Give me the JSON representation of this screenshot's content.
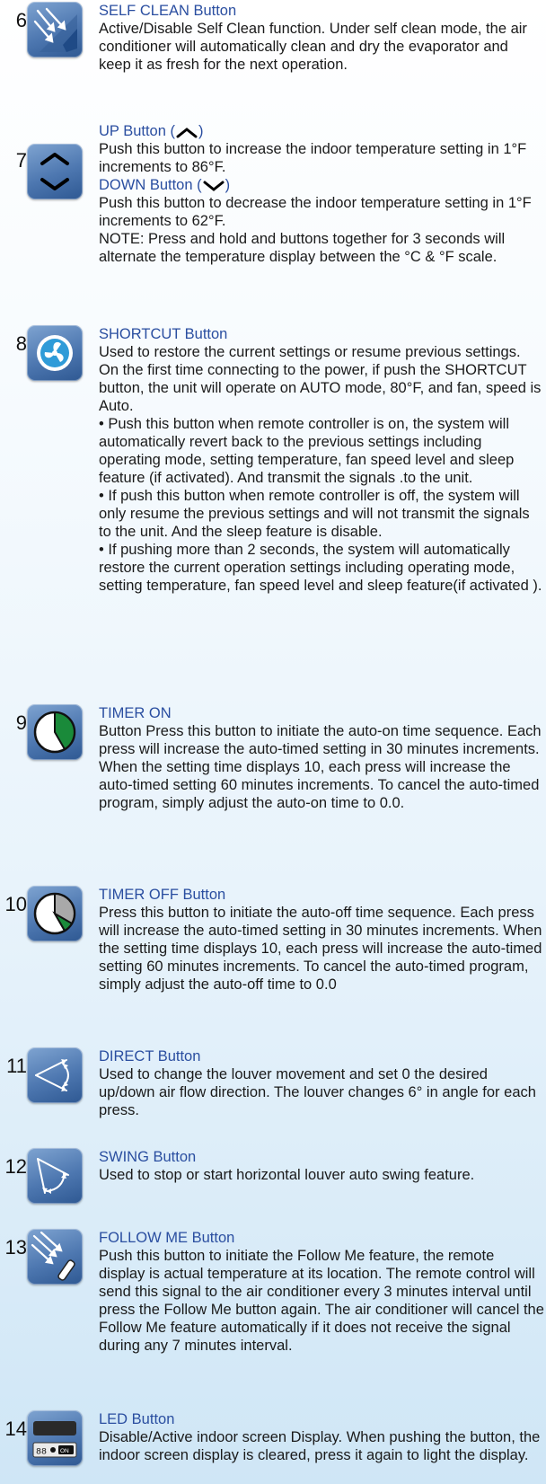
{
  "items": [
    {
      "number": "6",
      "icon": "self-clean-icon",
      "title": "SELF CLEAN Button",
      "paragraphs": [
        "Active/Disable Self Clean function. Under self clean mode, the air conditioner will automatically clean and dry the evaporator and keep it as fresh for the next operation."
      ]
    },
    {
      "number": "7",
      "icon": "up-down-icon",
      "title_up_prefix": "UP Button (",
      "title_up_suffix": ")",
      "up_text": "Push this button to increase the indoor temperature setting in 1°F increments to 86°F.",
      "title_down_prefix": "DOWN Button (",
      "title_down_suffix": ")",
      "down_text": "Push this button to decrease the indoor temperature setting in 1°F increments to 62°F.",
      "note": "NOTE: Press and hold and buttons together for 3 seconds will alternate the temperature display between the °C & °F scale."
    },
    {
      "number": "8",
      "icon": "shortcut-icon",
      "title": "SHORTCUT Button",
      "paragraphs": [
        "Used to restore the current settings or resume previous settings. On the first time connecting to the power, if push the SHORTCUT button, the unit will operate on AUTO mode, 80°F, and fan, speed is Auto.",
        "• Push this button when remote controller is on, the system will automatically revert back to the previous settings including operating mode, setting temperature, fan speed level and sleep feature (if activated). And transmit the signals .to the unit.",
        "• If push this button when remote controller is off, the system will only resume the previous settings and will not transmit the signals to the unit. And the sleep feature is disable.",
        "• If pushing more than 2 seconds, the system will automatically restore the current operation settings including operating mode, setting temperature, fan speed level and sleep feature(if activated )."
      ]
    },
    {
      "number": "9",
      "icon": "timer-on-icon",
      "title": "TIMER ON",
      "paragraphs": [
        "Button Press this button to initiate the auto-on time sequence. Each press will increase the auto-timed setting in 30 minutes increments. When the setting time displays 10, each press will increase the auto-timed setting 60 minutes increments. To cancel the auto-timed program, simply adjust the auto-on time to 0.0."
      ]
    },
    {
      "number": "10",
      "icon": "timer-off-icon",
      "title": "TIMER OFF Button",
      "paragraphs": [
        "Press this button to initiate the auto-off time sequence. Each press will increase the auto-timed setting in 30 minutes increments. When the setting time displays 10, each press will increase the auto-timed setting 60 minutes increments. To cancel the auto-timed program, simply adjust the auto-off time to 0.0"
      ]
    },
    {
      "number": "11",
      "icon": "direct-icon",
      "title": "DIRECT Button",
      "paragraphs": [
        "Used to change the louver movement and set 0 the desired up/down air flow direction. The louver changes 6° in angle for each press."
      ]
    },
    {
      "number": "12",
      "icon": "swing-icon",
      "title": "SWING Button",
      "paragraphs": [
        "Used to stop or start horizontal louver auto swing feature."
      ]
    },
    {
      "number": "13",
      "icon": "follow-me-icon",
      "title": "FOLLOW ME Button",
      "paragraphs": [
        "Push this button to initiate the Follow Me feature, the remote display is actual temperature at its location. The remote control will send this signal to the air conditioner every 3 minutes interval until press the Follow Me button again. The air conditioner will cancel the Follow Me feature automatically if it does not receive the signal during any 7 minutes interval."
      ]
    },
    {
      "number": "14",
      "icon": "led-icon",
      "title": "LED Button",
      "led_digits": "88",
      "led_on": "ON",
      "paragraphs": [
        "Disable/Active indoor screen Display. When pushing the button, the indoor screen display is cleared, press it again to light the display."
      ]
    }
  ]
}
